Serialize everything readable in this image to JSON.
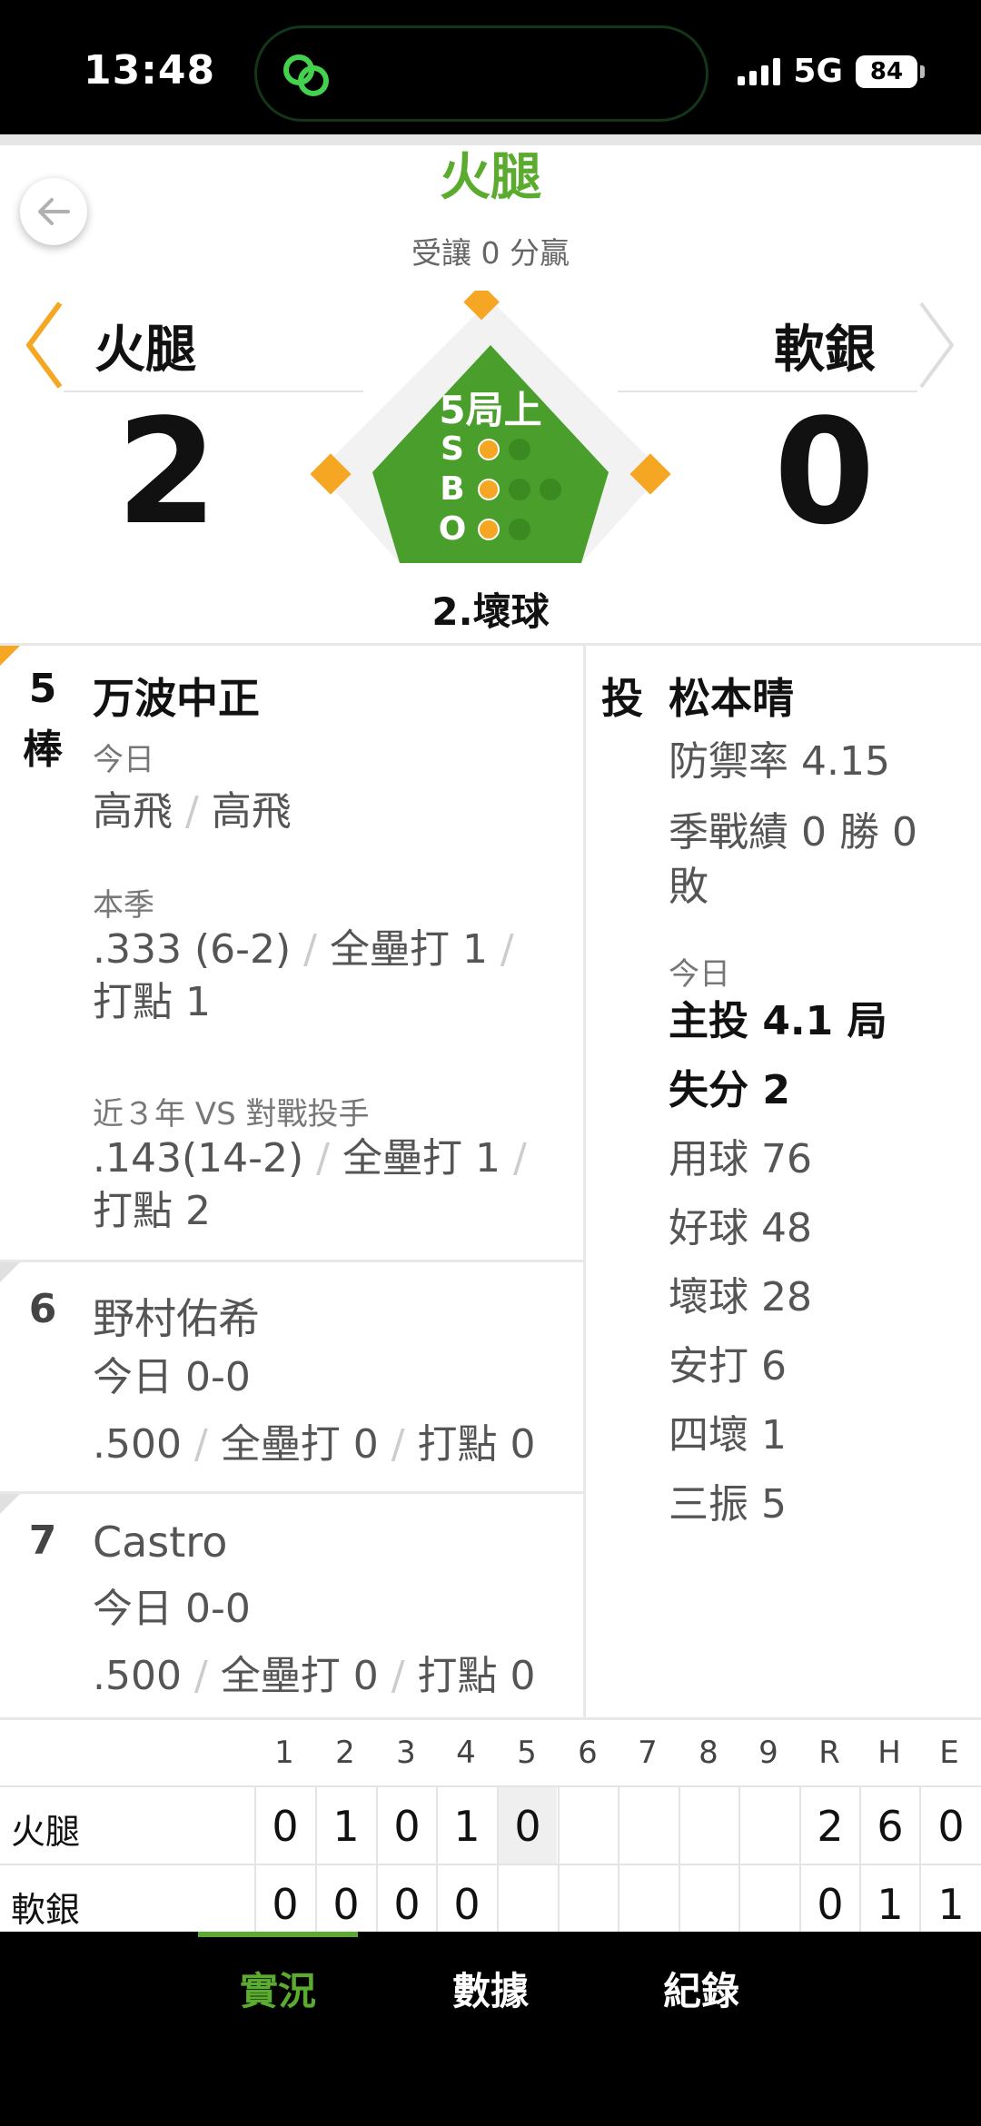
{
  "status_bar": {
    "time": "13:48",
    "network": "5G",
    "battery": "84"
  },
  "header": {
    "title": "火腿",
    "handicap": "受讓 0 分贏"
  },
  "teams": {
    "away": {
      "name": "火腿",
      "score": "2"
    },
    "home": {
      "name": "軟銀",
      "score": "0"
    }
  },
  "game_state": {
    "inning": "5局上",
    "count_labels": [
      "S",
      "B",
      "O"
    ],
    "strikes": 1,
    "balls": 1,
    "outs": 1,
    "batter_status": "2.壞球"
  },
  "batters": [
    {
      "order": "5",
      "suffix": "棒",
      "name": "万波中正",
      "today_label": "今日",
      "today_results": [
        "高飛",
        "高飛"
      ],
      "season_label": "本季",
      "season_line1": [
        ".333 (6-2)",
        "全壘打 1"
      ],
      "season_line2": "打點 1",
      "vs_label": "近３年 VS 對戰投手",
      "vs_line1": [
        ".143(14-2)",
        "全壘打 1"
      ],
      "vs_line2": "打點 2"
    },
    {
      "order": "6",
      "name": "野村佑希",
      "today": "今日 0-0",
      "stats": [
        ".500",
        "全壘打 0",
        "打點 0"
      ]
    },
    {
      "order": "7",
      "name": "Castro",
      "today": "今日 0-0",
      "stats": [
        ".500",
        "全壘打 0",
        "打點 0"
      ]
    }
  ],
  "pitcher": {
    "tag": "投",
    "name": "松本晴",
    "era": "防禦率 4.15",
    "record": "季戰績 0 勝 0 敗",
    "today_label": "今日",
    "innings": "主投 4.1 局",
    "runs": "失分 2",
    "pitches": "用球 76",
    "strikes": "好球 48",
    "balls": "壞球 28",
    "hits": "安打 6",
    "walks": "四壞 1",
    "strikeouts": "三振 5"
  },
  "linescore": {
    "columns": [
      "1",
      "2",
      "3",
      "4",
      "5",
      "6",
      "7",
      "8",
      "9",
      "R",
      "H",
      "E"
    ],
    "rows": [
      {
        "team": "火腿",
        "cells": [
          "0",
          "1",
          "0",
          "1",
          "0",
          "",
          "",
          "",
          "",
          "2",
          "6",
          "0"
        ]
      },
      {
        "team": "軟銀",
        "cells": [
          "0",
          "0",
          "0",
          "0",
          "",
          "",
          "",
          "",
          "",
          "0",
          "1",
          "1"
        ]
      }
    ]
  },
  "tabs": [
    "實況",
    "數據",
    "紀錄"
  ],
  "colors": {
    "accent": "#5aab2e",
    "diamond": "#4a9e2c",
    "base": "#f5a623"
  }
}
